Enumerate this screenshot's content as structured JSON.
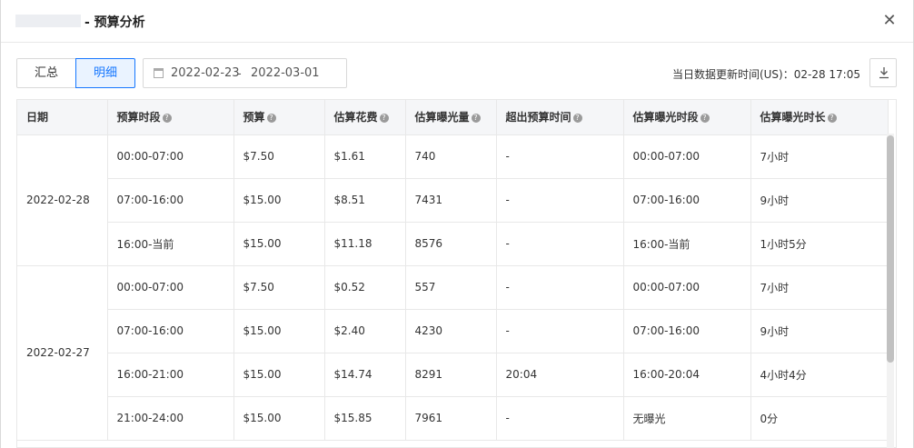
{
  "dialog": {
    "title": "- 预算分析",
    "close_icon": "close-icon"
  },
  "toolbar": {
    "tabs": [
      {
        "label": "汇总",
        "active": false
      },
      {
        "label": "明细",
        "active": true
      }
    ],
    "date_range": {
      "start": "2022-02-23",
      "separator": "-",
      "end": "2022-03-01"
    },
    "update_text": "当日数据更新时间(US)：02-28 17:05",
    "download_icon": "download-icon"
  },
  "table": {
    "columns": [
      "日期",
      "预算时段",
      "预算",
      "估算花费",
      "估算曝光量",
      "超出预算时间",
      "估算曝光时段",
      "估算曝光时长"
    ],
    "help_icon_glyph": "?",
    "groups": [
      {
        "date": "2022-02-28",
        "rows": [
          [
            "00:00-07:00",
            "$7.50",
            "$1.61",
            "740",
            "-",
            "00:00-07:00",
            "7小时"
          ],
          [
            "07:00-16:00",
            "$15.00",
            "$8.51",
            "7431",
            "-",
            "07:00-16:00",
            "9小时"
          ],
          [
            "16:00-当前",
            "$15.00",
            "$11.18",
            "8576",
            "-",
            "16:00-当前",
            "1小时5分"
          ]
        ]
      },
      {
        "date": "2022-02-27",
        "rows": [
          [
            "00:00-07:00",
            "$7.50",
            "$0.52",
            "557",
            "-",
            "00:00-07:00",
            "7小时"
          ],
          [
            "07:00-16:00",
            "$15.00",
            "$2.40",
            "4230",
            "-",
            "07:00-16:00",
            "9小时"
          ],
          [
            "16:00-21:00",
            "$15.00",
            "$14.74",
            "8291",
            "20:04",
            "16:00-20:04",
            "4小时4分"
          ],
          [
            "21:00-24:00",
            "$15.00",
            "$15.85",
            "7961",
            "-",
            "无曝光",
            "0分"
          ]
        ]
      }
    ]
  }
}
